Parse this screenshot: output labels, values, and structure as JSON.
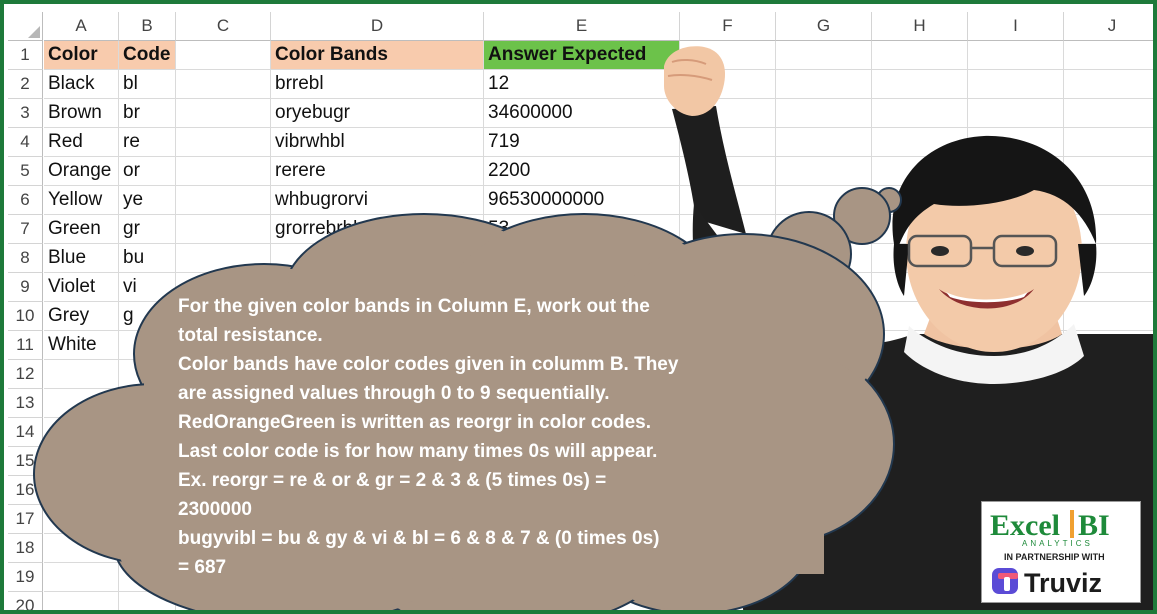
{
  "spreadsheet": {
    "columns": [
      "A",
      "B",
      "C",
      "D",
      "E",
      "F",
      "G",
      "H",
      "I",
      "J"
    ],
    "rows": [
      "1",
      "2",
      "3",
      "4",
      "5",
      "6",
      "7",
      "8",
      "9",
      "10",
      "11",
      "12",
      "13",
      "14",
      "15",
      "16",
      "17",
      "18",
      "19",
      "20"
    ],
    "headers": {
      "color": "Color",
      "code": "Code",
      "color_bands": "Color Bands",
      "answer_expected": "Answer Expected"
    },
    "color_codes": [
      {
        "color": "Black",
        "code": "bl"
      },
      {
        "color": "Brown",
        "code": "br"
      },
      {
        "color": "Red",
        "code": "re"
      },
      {
        "color": "Orange",
        "code": "or"
      },
      {
        "color": "Yellow",
        "code": "ye"
      },
      {
        "color": "Green",
        "code": "gr"
      },
      {
        "color": "Blue",
        "code": "bu"
      },
      {
        "color": "Violet",
        "code": "vi"
      },
      {
        "color": "Grey",
        "code": "g"
      },
      {
        "color": "White",
        "code": ""
      }
    ],
    "bands": [
      {
        "band": "brrebl",
        "answer": "12"
      },
      {
        "band": "oryebugr",
        "answer": "34600000"
      },
      {
        "band": "vibrwhbl",
        "answer": "719"
      },
      {
        "band": "rerere",
        "answer": "2200"
      },
      {
        "band": "whbugrorvi",
        "answer": "96530000000"
      },
      {
        "band": "grorrebrblyi",
        "answer": "53"
      },
      {
        "band": "",
        "answer": ""
      }
    ]
  },
  "callout": {
    "lines": [
      "For the given color bands in Column E, work out the",
      "total resistance.",
      "Color bands have color codes given in columm B. They",
      "are assigned values through 0 to 9 sequentially.",
      "RedOrangeGreen is written as reorgr in color codes.",
      "Last color code is for how many times 0s will appear.",
      "Ex. reorgr = re & or & gr = 2 & 3 & (5 times 0s) =",
      "2300000",
      "bugyvibl = bu & gy & vi & bl = 6 & 8 & 7 & (0 times 0s)",
      "= 687"
    ]
  },
  "logo": {
    "brand_left": "Excel",
    "brand_right": "BI",
    "tagline": "ANALYTICS",
    "partnership": "IN PARTNERSHIP WITH",
    "partner": "Truviz"
  },
  "colors": {
    "frame": "#1e7a3a",
    "header_orange": "#f8cbad",
    "header_green": "#6cc24a",
    "cloud": "#a89584",
    "cloud_outline": "#22384f"
  }
}
